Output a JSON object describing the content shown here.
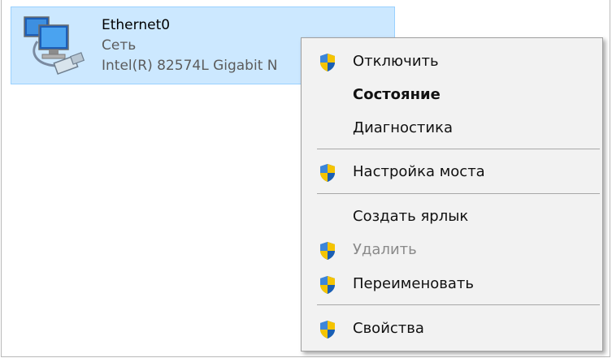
{
  "adapter": {
    "name": "Ethernet0",
    "network": "Сеть",
    "device": "Intel(R) 82574L Gigabit N",
    "icon": "network-adapter-icon"
  },
  "menu": {
    "items": [
      {
        "label": "Отключить",
        "icon": "uac-shield-icon",
        "state": "normal"
      },
      {
        "label": "Состояние",
        "icon": "",
        "state": "default-bold"
      },
      {
        "label": "Диагностика",
        "icon": "",
        "state": "normal"
      },
      {
        "label": "Настройка моста",
        "icon": "uac-shield-icon",
        "state": "normal"
      },
      {
        "label": "Создать ярлык",
        "icon": "",
        "state": "normal"
      },
      {
        "label": "Удалить",
        "icon": "uac-shield-icon",
        "state": "disabled"
      },
      {
        "label": "Переименовать",
        "icon": "uac-shield-icon",
        "state": "normal"
      },
      {
        "label": "Свойства",
        "icon": "uac-shield-icon",
        "state": "normal"
      }
    ]
  },
  "colors": {
    "selection_bg": "#cce8ff",
    "selection_border": "#99d1ff",
    "menu_bg": "#f2f2f2",
    "shield_blue": "#1a5fb4",
    "shield_yellow": "#f5c400"
  }
}
